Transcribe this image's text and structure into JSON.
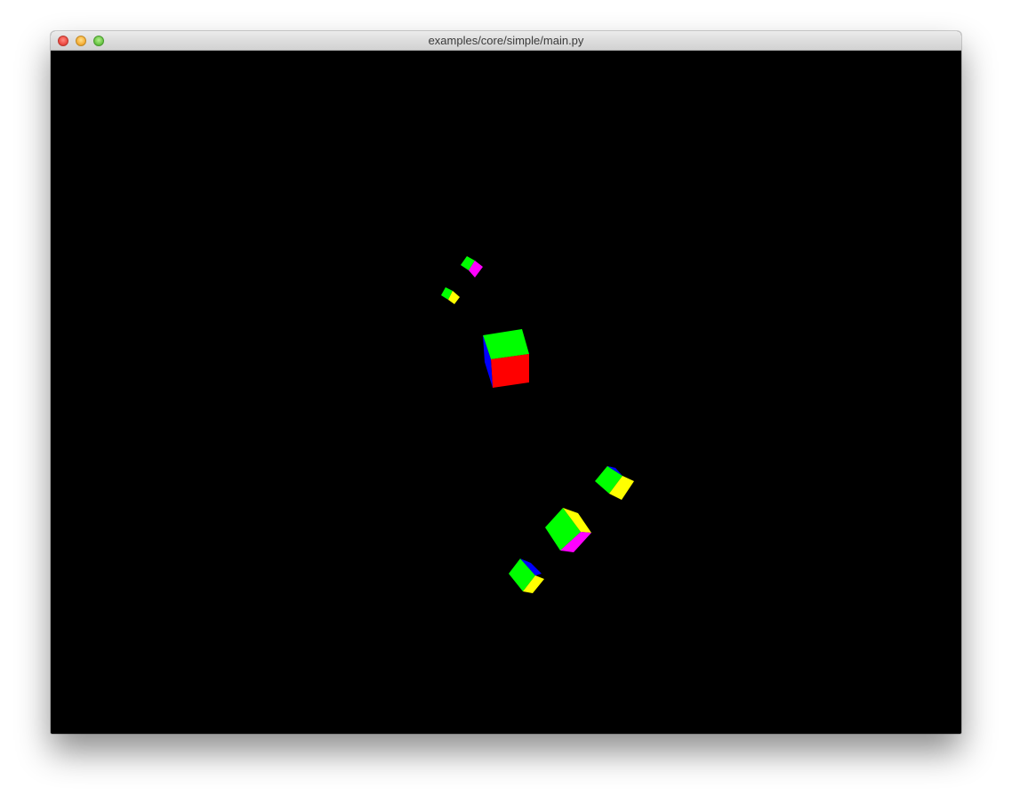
{
  "window": {
    "title": "examples/core/simple/main.py"
  },
  "scene": {
    "background": "#000000",
    "face_colors": {
      "green": "#00ff00",
      "red": "#ff0000",
      "blue": "#0000ff",
      "magenta": "#ff00ff",
      "yellow": "#ffff00"
    },
    "object_type": "cube",
    "object_count": 6
  }
}
